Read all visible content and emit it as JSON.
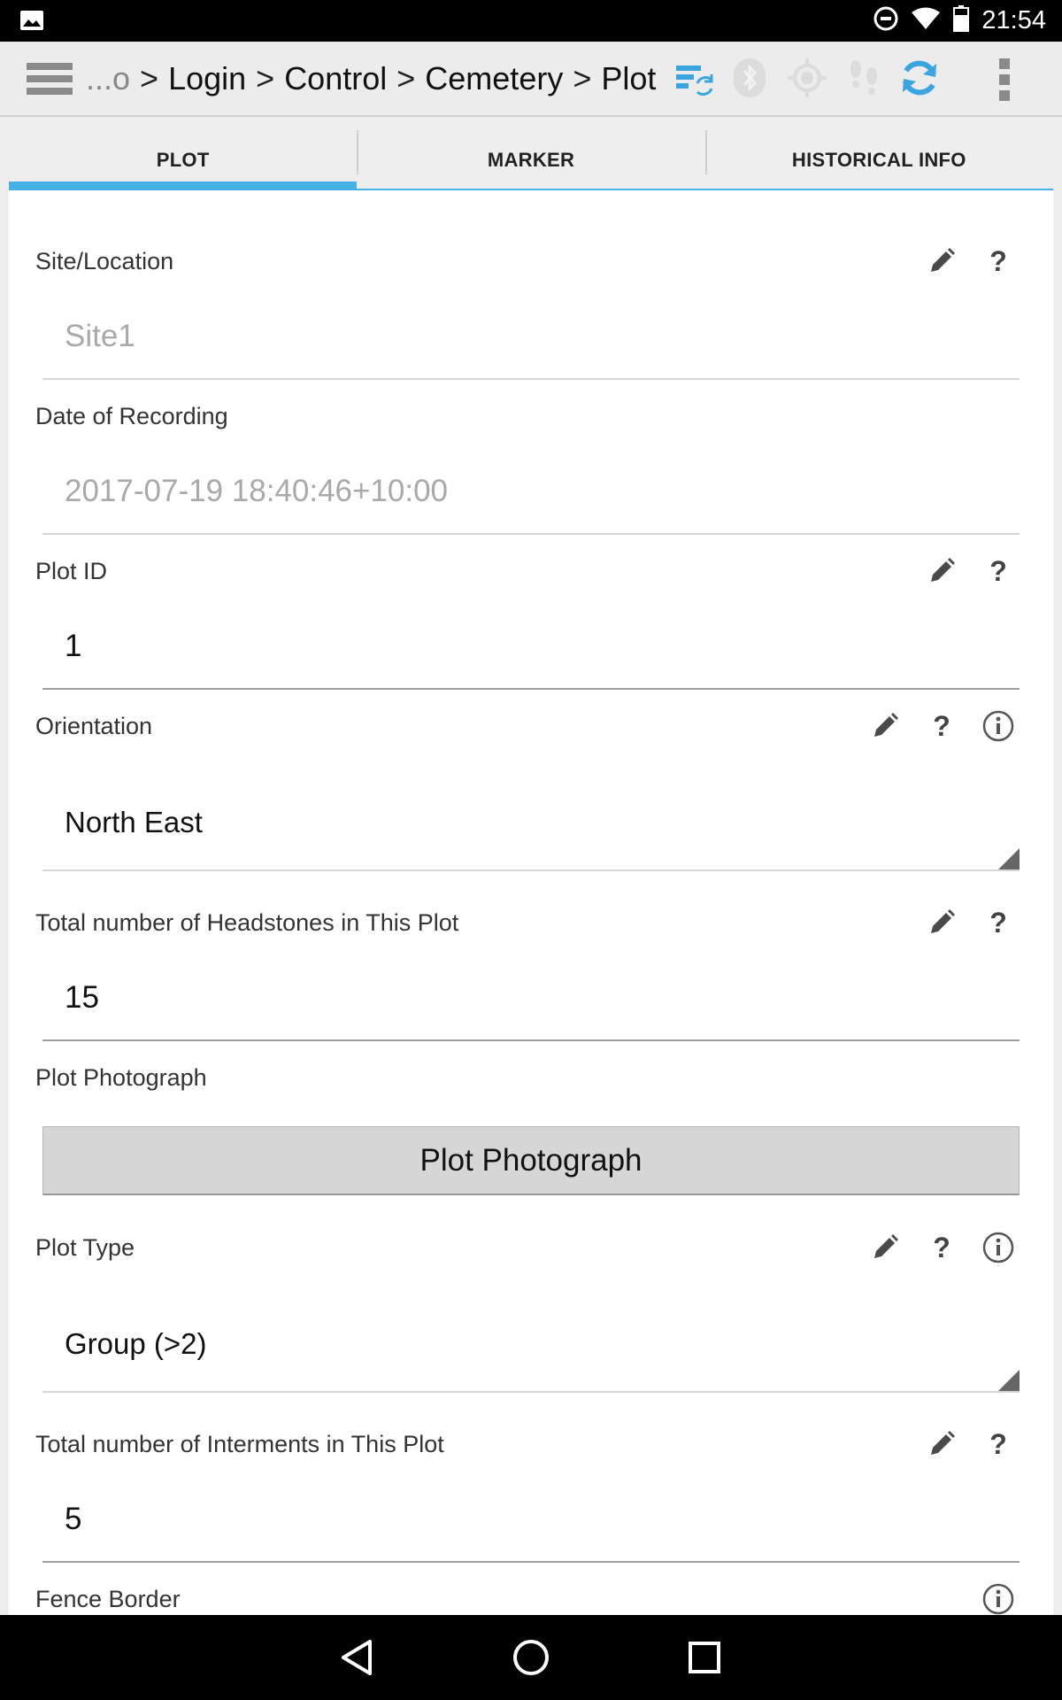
{
  "status_bar": {
    "time": "21:54",
    "icons": [
      "image-notification-icon",
      "do-not-disturb-icon",
      "wifi-icon",
      "battery-icon"
    ]
  },
  "action_bar": {
    "menu_icon": "menu-icon",
    "breadcrumb": {
      "ellipsis": "...o",
      "separator": ">",
      "items": [
        "Login",
        "Control",
        "Cemetery",
        "Plot"
      ]
    },
    "actions": [
      "sync-records-icon",
      "bluetooth-icon",
      "gps-icon",
      "footsteps-icon",
      "refresh-icon",
      "overflow-menu-icon"
    ],
    "accent_color": "#3aa5df"
  },
  "tabs": [
    {
      "label": "PLOT",
      "active": true
    },
    {
      "label": "MARKER",
      "active": false
    },
    {
      "label": "HISTORICAL INFO",
      "active": false
    }
  ],
  "form": {
    "site_location": {
      "label": "Site/Location",
      "value": "Site1"
    },
    "date_of_recording": {
      "label": "Date of Recording",
      "value": "2017-07-19 18:40:46+10:00"
    },
    "plot_id": {
      "label": "Plot ID",
      "value": "1"
    },
    "orientation": {
      "label": "Orientation",
      "value": "North East"
    },
    "total_headstones": {
      "label": "Total number of Headstones in This Plot",
      "value": "15"
    },
    "plot_photograph": {
      "label": "Plot Photograph",
      "button_label": "Plot Photograph"
    },
    "plot_type": {
      "label": "Plot Type",
      "value": "Group (>2)"
    },
    "total_interments": {
      "label": "Total number of Interments in This Plot",
      "value": "5"
    },
    "fence_border": {
      "label": "Fence Border"
    }
  },
  "help_glyph": "?",
  "nav_bar": [
    "back-icon",
    "home-icon",
    "recents-icon"
  ]
}
